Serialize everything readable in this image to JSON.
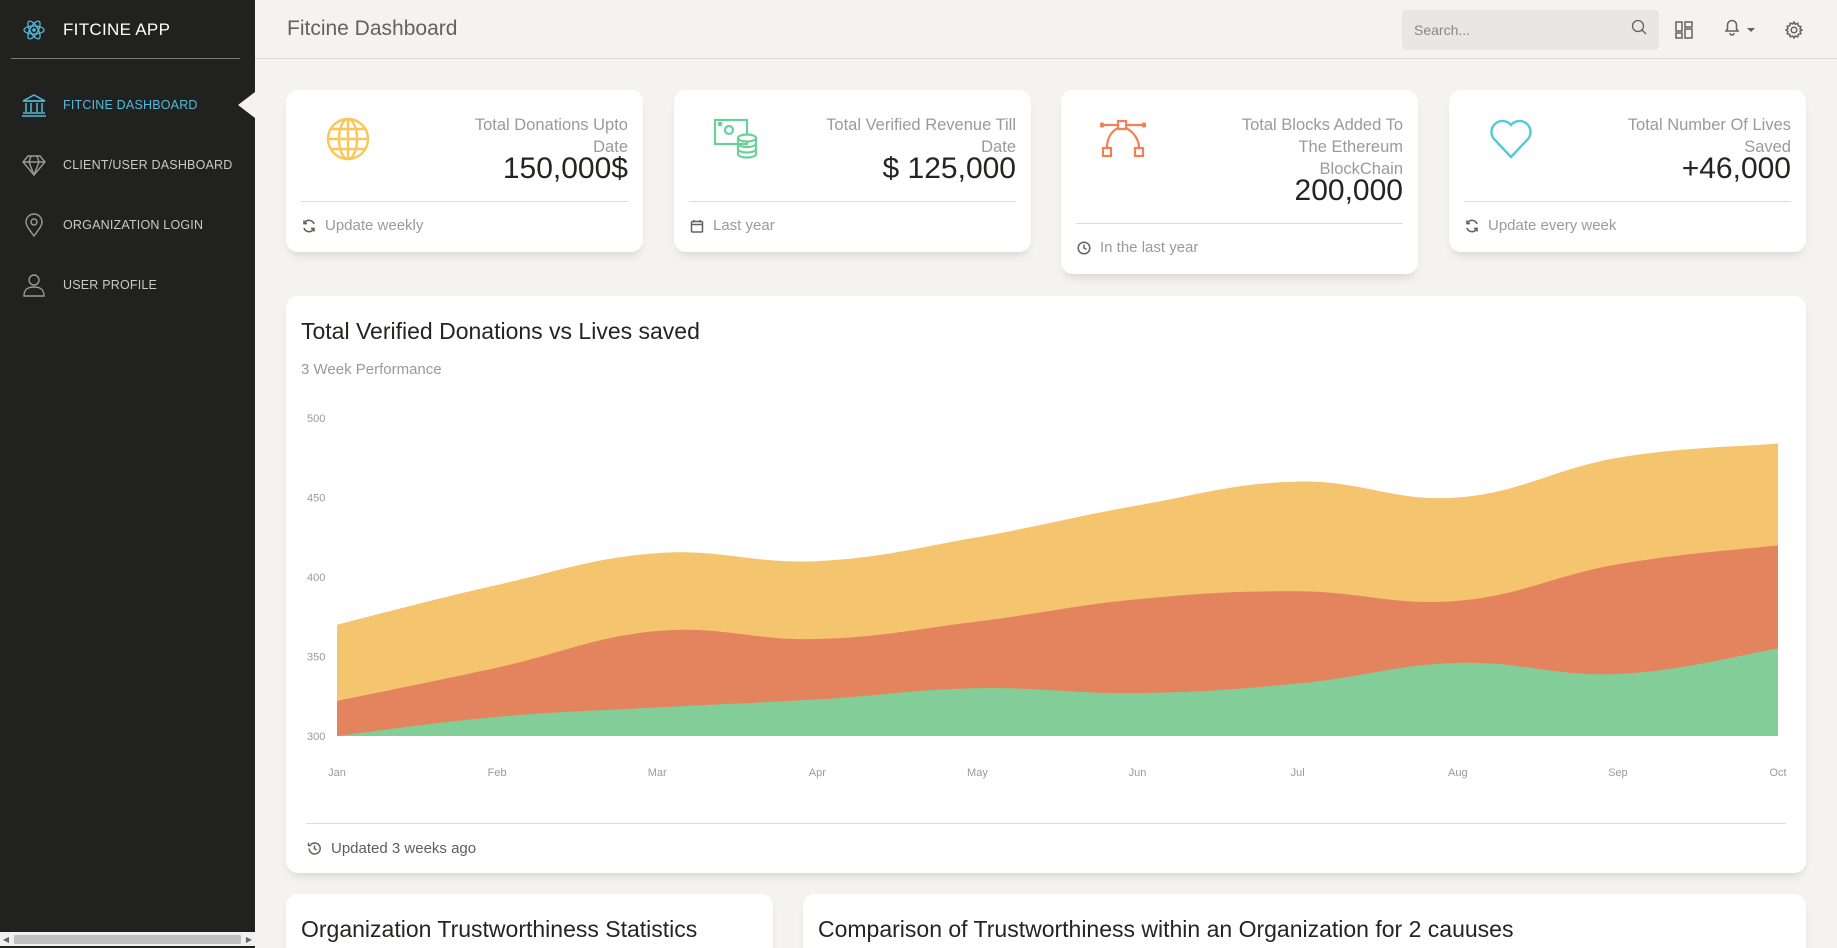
{
  "app": {
    "name": "FITCINE APP",
    "page_title": "Fitcine Dashboard"
  },
  "sidebar": {
    "items": [
      {
        "label": "FITCINE DASHBOARD",
        "icon": "bank-icon",
        "active": true
      },
      {
        "label": "CLIENT/USER DASHBOARD",
        "icon": "diamond-icon",
        "active": false
      },
      {
        "label": "ORGANIZATION LOGIN",
        "icon": "pin-icon",
        "active": false
      },
      {
        "label": "USER PROFILE",
        "icon": "user-icon",
        "active": false
      }
    ]
  },
  "topbar": {
    "search_placeholder": "Search...",
    "icons": [
      "search-icon",
      "dashboard-grid-icon",
      "bell-icon",
      "gear-icon"
    ]
  },
  "stats": [
    {
      "label": "Total Donations Upto Date",
      "value": "150,000$",
      "footer": "Update weekly",
      "icon": "globe-icon",
      "footer_icon": "refresh-icon",
      "color": "#fbc658"
    },
    {
      "label": "Total Verified Revenue Till Date",
      "value": "$ 125,000",
      "footer": "Last year",
      "icon": "money-coins-icon",
      "footer_icon": "calendar-icon",
      "color": "#6bd098"
    },
    {
      "label": "Total Blocks Added To The Ethereum BlockChain",
      "value": "200,000",
      "footer": "In the last year",
      "icon": "vector-curve-icon",
      "footer_icon": "clock-icon",
      "color": "#ef8157"
    },
    {
      "label": "Total Number Of Lives Saved",
      "value": "+46,000",
      "footer": "Update every week",
      "icon": "heart-icon",
      "footer_icon": "refresh-icon",
      "color": "#51cbce"
    }
  ],
  "main_chart": {
    "title": "Total Verified Donations vs Lives saved",
    "subtitle": "3 Week Performance",
    "footer": "Updated 3 weeks ago",
    "footer_icon": "history-icon"
  },
  "bottom_cards": [
    {
      "title": "Organization Trustworthiness Statistics"
    },
    {
      "title": "Comparison of Trustworthiness within an Organization for 2 cauuses"
    }
  ],
  "chart_data": {
    "type": "area",
    "stacked": false,
    "categories": [
      "Jan",
      "Feb",
      "Mar",
      "Apr",
      "May",
      "Jun",
      "Jul",
      "Aug",
      "Sep",
      "Oct"
    ],
    "ylim": [
      300,
      500
    ],
    "yticks": [
      300,
      350,
      400,
      450,
      500
    ],
    "grid": false,
    "legend": "none",
    "series": [
      {
        "values": [
          370,
          395,
          415,
          410,
          425,
          445,
          460,
          450,
          475,
          484
        ],
        "color": "#f4c46e"
      },
      {
        "values": [
          322,
          343,
          366,
          361,
          372,
          386,
          391,
          385,
          408,
          420
        ],
        "color": "#e4845f"
      },
      {
        "values": [
          300,
          312,
          318,
          323,
          330,
          327,
          333,
          346,
          339,
          355
        ],
        "color": "#83cd98"
      }
    ]
  }
}
